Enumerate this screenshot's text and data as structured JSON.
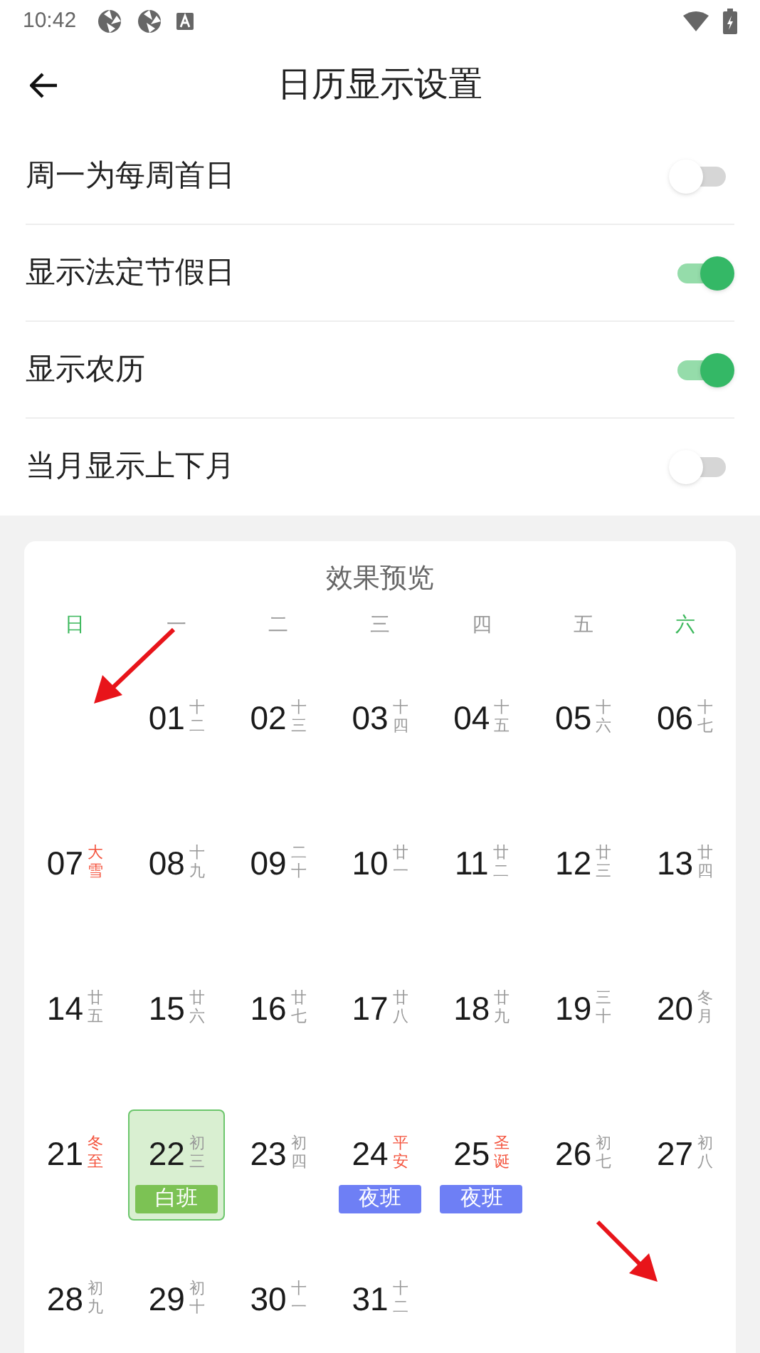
{
  "status_bar": {
    "time": "10:42"
  },
  "header": {
    "title": "日历显示设置"
  },
  "settings": [
    {
      "label": "周一为每周首日",
      "on": false
    },
    {
      "label": "显示法定节假日",
      "on": true
    },
    {
      "label": "显示农历",
      "on": true
    },
    {
      "label": "当月显示上下月",
      "on": false
    }
  ],
  "preview": {
    "title": "效果预览",
    "weekdays": [
      {
        "label": "日",
        "color": "#3cb85c"
      },
      {
        "label": "一",
        "color": "#999999"
      },
      {
        "label": "二",
        "color": "#999999"
      },
      {
        "label": "三",
        "color": "#999999"
      },
      {
        "label": "四",
        "color": "#999999"
      },
      {
        "label": "五",
        "color": "#999999"
      },
      {
        "label": "六",
        "color": "#3cb85c"
      }
    ],
    "weeks": [
      [
        {
          "kind": "empty"
        },
        {
          "kind": "day",
          "date": "01",
          "lunar": "十二",
          "festival": false,
          "selected": false
        },
        {
          "kind": "day",
          "date": "02",
          "lunar": "十三",
          "festival": false,
          "selected": false
        },
        {
          "kind": "day",
          "date": "03",
          "lunar": "十四",
          "festival": false,
          "selected": false
        },
        {
          "kind": "day",
          "date": "04",
          "lunar": "十五",
          "festival": false,
          "selected": false
        },
        {
          "kind": "day",
          "date": "05",
          "lunar": "十六",
          "festival": false,
          "selected": false
        },
        {
          "kind": "day",
          "date": "06",
          "lunar": "十七",
          "festival": false,
          "selected": false
        }
      ],
      [
        {
          "kind": "day",
          "date": "07",
          "lunar": "大雪",
          "festival": true,
          "selected": false
        },
        {
          "kind": "day",
          "date": "08",
          "lunar": "十九",
          "festival": false,
          "selected": false
        },
        {
          "kind": "day",
          "date": "09",
          "lunar": "二十",
          "festival": false,
          "selected": false
        },
        {
          "kind": "day",
          "date": "10",
          "lunar": "廿一",
          "festival": false,
          "selected": false
        },
        {
          "kind": "day",
          "date": "11",
          "lunar": "廿二",
          "festival": false,
          "selected": false
        },
        {
          "kind": "day",
          "date": "12",
          "lunar": "廿三",
          "festival": false,
          "selected": false
        },
        {
          "kind": "day",
          "date": "13",
          "lunar": "廿四",
          "festival": false,
          "selected": false
        }
      ],
      [
        {
          "kind": "day",
          "date": "14",
          "lunar": "廿五",
          "festival": false,
          "selected": false
        },
        {
          "kind": "day",
          "date": "15",
          "lunar": "廿六",
          "festival": false,
          "selected": false
        },
        {
          "kind": "day",
          "date": "16",
          "lunar": "廿七",
          "festival": false,
          "selected": false
        },
        {
          "kind": "day",
          "date": "17",
          "lunar": "廿八",
          "festival": false,
          "selected": false
        },
        {
          "kind": "day",
          "date": "18",
          "lunar": "廿九",
          "festival": false,
          "selected": false
        },
        {
          "kind": "day",
          "date": "19",
          "lunar": "三十",
          "festival": false,
          "selected": false
        },
        {
          "kind": "day",
          "date": "20",
          "lunar": "冬月",
          "festival": false,
          "selected": false
        }
      ],
      [
        {
          "kind": "day",
          "date": "21",
          "lunar": "冬至",
          "festival": true,
          "selected": false
        },
        {
          "kind": "day",
          "date": "22",
          "lunar": "初三",
          "festival": false,
          "selected": true,
          "shift": {
            "kind": "day",
            "label": "白班"
          }
        },
        {
          "kind": "day",
          "date": "23",
          "lunar": "初四",
          "festival": false,
          "selected": false
        },
        {
          "kind": "day",
          "date": "24",
          "lunar": "平安",
          "festival": true,
          "selected": false,
          "shift": {
            "kind": "night",
            "label": "夜班"
          }
        },
        {
          "kind": "day",
          "date": "25",
          "lunar": "圣诞",
          "festival": true,
          "selected": false,
          "shift": {
            "kind": "night",
            "label": "夜班"
          }
        },
        {
          "kind": "day",
          "date": "26",
          "lunar": "初七",
          "festival": false,
          "selected": false
        },
        {
          "kind": "day",
          "date": "27",
          "lunar": "初八",
          "festival": false,
          "selected": false
        }
      ],
      [
        {
          "kind": "day",
          "date": "28",
          "lunar": "初九",
          "festival": false,
          "selected": false
        },
        {
          "kind": "day",
          "date": "29",
          "lunar": "初十",
          "festival": false,
          "selected": false
        },
        {
          "kind": "day",
          "date": "30",
          "lunar": "十一",
          "festival": false,
          "selected": false
        },
        {
          "kind": "day",
          "date": "31",
          "lunar": "十二",
          "festival": false,
          "selected": false
        }
      ]
    ]
  }
}
